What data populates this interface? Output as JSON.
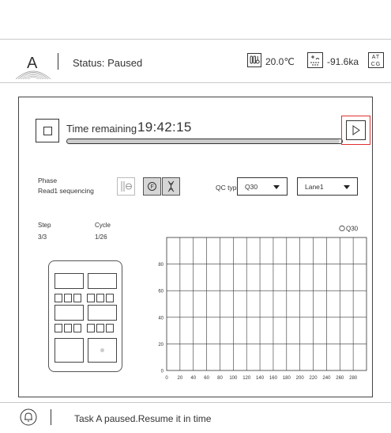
{
  "header": {
    "status": "Status: Paused",
    "temperature_icon": "thermometer-icon",
    "temperature": "20.0℃",
    "temperature_value": 20.0,
    "pressure_icon": "pressure-icon",
    "pressure": "-91.6ka",
    "pressure_value": -91.6,
    "atcg": [
      "AT",
      "CG"
    ],
    "logo": "A"
  },
  "run": {
    "time_label": "Time remaining",
    "time_value": "19:42:15",
    "progress": 0.99
  },
  "phase": {
    "label": "Phase",
    "value": "Read1 sequencing"
  },
  "qc": {
    "label": "QC type",
    "qc_selected": "Q30",
    "lane_selected": "Lane1"
  },
  "step": {
    "label": "Step",
    "value": "3/3"
  },
  "cycle": {
    "label": "Cycle",
    "value": "1/26"
  },
  "footer": {
    "message": "Task A paused.Resume it in time",
    "icon": "bell-icon"
  },
  "colors": {
    "highlight": "#e03030",
    "line": "#333333"
  },
  "chart_data": {
    "type": "line",
    "series": [
      {
        "name": "Q30",
        "values": []
      }
    ],
    "x_ticks": [
      "0",
      "20",
      "40",
      "60",
      "80",
      "100",
      "120",
      "140",
      "160",
      "180",
      "200",
      "220",
      "240",
      "260",
      "280"
    ],
    "y_ticks": [
      "0",
      "20",
      "40",
      "60",
      "80"
    ],
    "xlim": [
      0,
      300
    ],
    "ylim": [
      0,
      100
    ],
    "grid": true,
    "legend": "top-right"
  }
}
